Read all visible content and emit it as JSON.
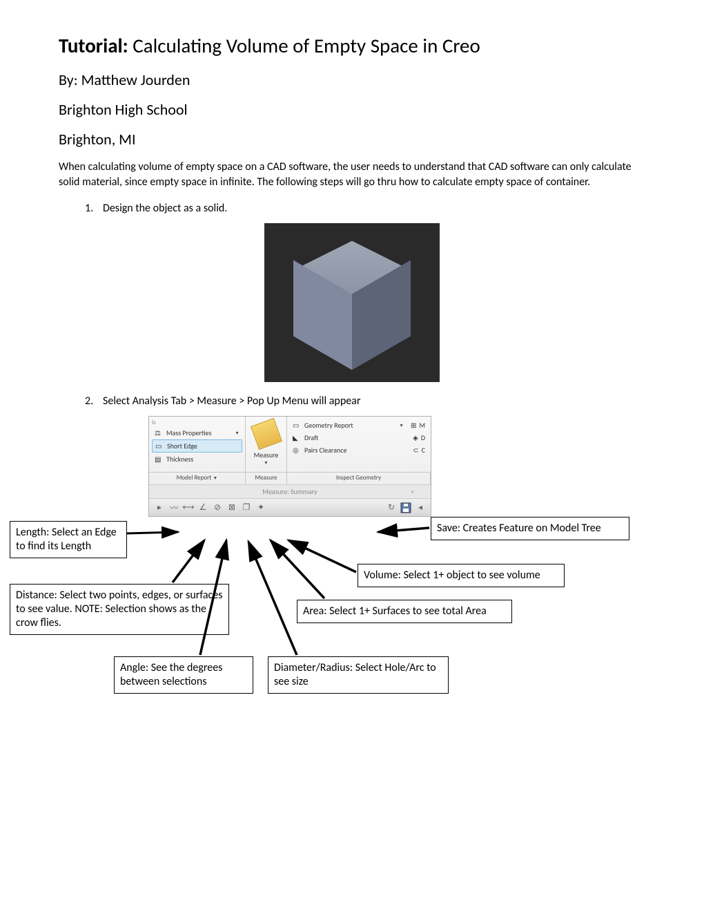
{
  "title_bold": "Tutorial:",
  "title_rest": " Calculating Volume of Empty Space in Creo",
  "byline": "By: Matthew Jourden",
  "school": "Brighton High School",
  "city": "Brighton, MI",
  "intro": "When calculating volume of empty space on a CAD software, the user needs to understand that CAD software can only calculate solid material, since empty space in infinite.  The following steps will go thru how to calculate empty space of container.",
  "steps": [
    "Design the object as a solid.",
    "Select Analysis Tab > Measure > Pop Up Menu will appear"
  ],
  "ribbon": {
    "left_partial": "is",
    "mass_properties": "Mass Properties",
    "short_edge": "Short Edge",
    "thickness": "Thickness",
    "model_report": "Model Report",
    "measure_btn": "Measure",
    "geometry_report": "Geometry Report",
    "draft": "Draft",
    "pairs_clearance": "Pairs Clearance",
    "right_m": "M",
    "right_d": "D",
    "right_c": "C",
    "footer_measure": "Measure",
    "footer_inspect": "Inspect Geometry",
    "summary_title": "Measure: Summary"
  },
  "callouts": {
    "length": "Length: Select an Edge to find its Length",
    "distance": "Distance: Select two points, edges, or surfaces to see value. NOTE: Selection shows as the crow flies.",
    "angle": "Angle: See the degrees between selections",
    "diameter": "Diameter/Radius: Select Hole/Arc to see size",
    "area": "Area: Select 1+ Surfaces to see total Area",
    "volume": "Volume: Select 1+ object to see volume",
    "save": "Save: Creates Feature on Model Tree"
  }
}
